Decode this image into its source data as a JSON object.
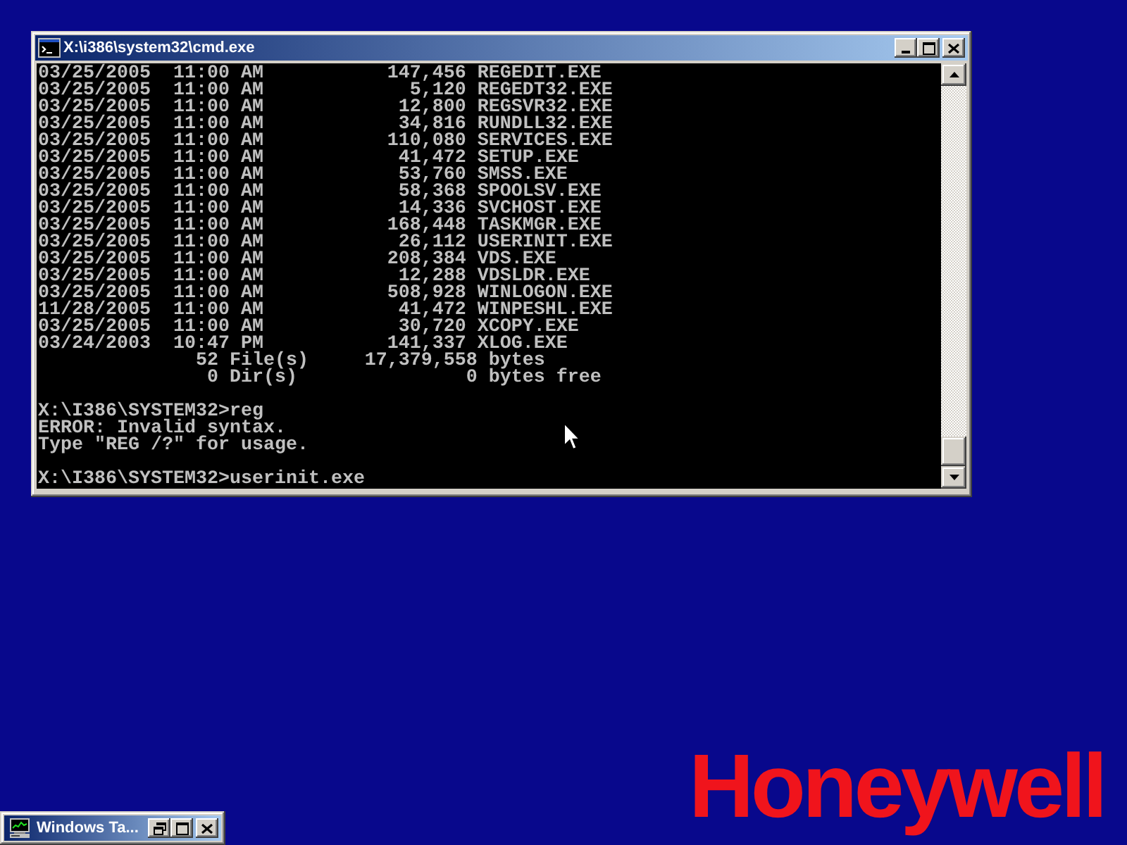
{
  "console_window": {
    "title": "X:\\i386\\system32\\cmd.exe",
    "listing": [
      {
        "date": "03/25/2005",
        "time": "11:00 AM",
        "size": "147,456",
        "name": "REGEDIT.EXE"
      },
      {
        "date": "03/25/2005",
        "time": "11:00 AM",
        "size": "5,120",
        "name": "REGEDT32.EXE"
      },
      {
        "date": "03/25/2005",
        "time": "11:00 AM",
        "size": "12,800",
        "name": "REGSVR32.EXE"
      },
      {
        "date": "03/25/2005",
        "time": "11:00 AM",
        "size": "34,816",
        "name": "RUNDLL32.EXE"
      },
      {
        "date": "03/25/2005",
        "time": "11:00 AM",
        "size": "110,080",
        "name": "SERVICES.EXE"
      },
      {
        "date": "03/25/2005",
        "time": "11:00 AM",
        "size": "41,472",
        "name": "SETUP.EXE"
      },
      {
        "date": "03/25/2005",
        "time": "11:00 AM",
        "size": "53,760",
        "name": "SMSS.EXE"
      },
      {
        "date": "03/25/2005",
        "time": "11:00 AM",
        "size": "58,368",
        "name": "SPOOLSV.EXE"
      },
      {
        "date": "03/25/2005",
        "time": "11:00 AM",
        "size": "14,336",
        "name": "SVCHOST.EXE"
      },
      {
        "date": "03/25/2005",
        "time": "11:00 AM",
        "size": "168,448",
        "name": "TASKMGR.EXE"
      },
      {
        "date": "03/25/2005",
        "time": "11:00 AM",
        "size": "26,112",
        "name": "USERINIT.EXE"
      },
      {
        "date": "03/25/2005",
        "time": "11:00 AM",
        "size": "208,384",
        "name": "VDS.EXE"
      },
      {
        "date": "03/25/2005",
        "time": "11:00 AM",
        "size": "12,288",
        "name": "VDSLDR.EXE"
      },
      {
        "date": "03/25/2005",
        "time": "11:00 AM",
        "size": "508,928",
        "name": "WINLOGON.EXE"
      },
      {
        "date": "11/28/2005",
        "time": "11:00 AM",
        "size": "41,472",
        "name": "WINPESHL.EXE"
      },
      {
        "date": "03/25/2005",
        "time": "11:00 AM",
        "size": "30,720",
        "name": "XCOPY.EXE"
      },
      {
        "date": "03/24/2003",
        "time": "10:47 PM",
        "size": "141,337",
        "name": "XLOG.EXE"
      }
    ],
    "summary": [
      {
        "count": "52",
        "label": "File(s)",
        "amount": "17,379,558",
        "unit": "bytes"
      },
      {
        "count": "0",
        "label": "Dir(s)",
        "amount": "0",
        "unit": "bytes free"
      }
    ],
    "sessions": [
      {
        "input": "X:\\I386\\SYSTEM32>reg",
        "output": [
          "ERROR: Invalid syntax.",
          "Type \"REG /?\" for usage."
        ]
      },
      {
        "input": "X:\\I386\\SYSTEM32>userinit.exe"
      }
    ]
  },
  "minimized_window": {
    "title": "Windows Ta..."
  },
  "desktop": {
    "logo": "Honeywell"
  }
}
